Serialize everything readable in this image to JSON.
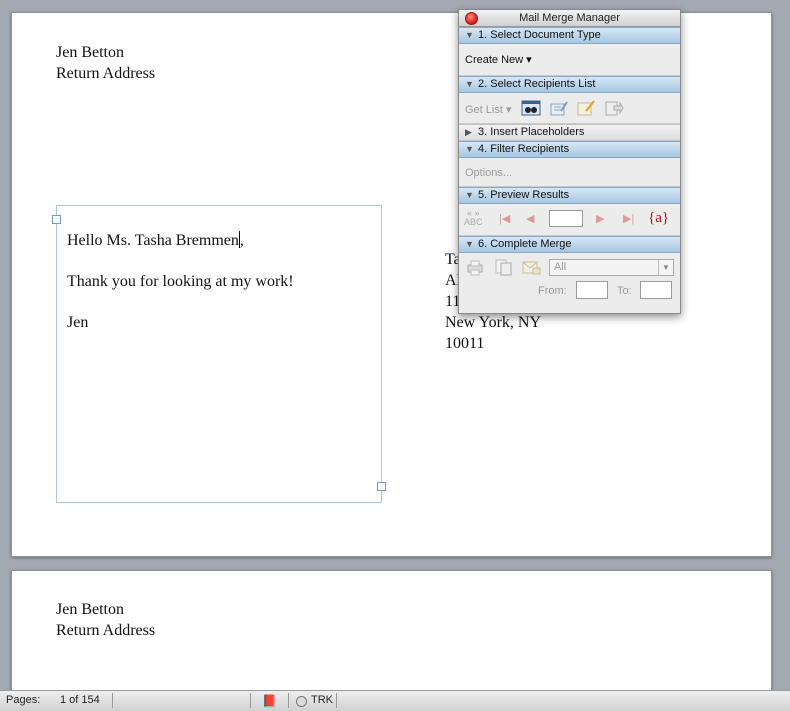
{
  "document": {
    "return_address": {
      "name": "Jen Betton",
      "line2": "Return Address"
    },
    "letter": {
      "greeting": "Hello Ms. Tasha Bremmen",
      "body": "Thank you for looking at my work!",
      "signature": "Jen"
    },
    "recipient_address": {
      "line1": "Ta",
      "line2": "Al",
      "line3": "11",
      "city_state": "New York, NY",
      "zip": "10011"
    }
  },
  "page2": {
    "return_address": {
      "name": "Jen Betton",
      "line2": "Return Address"
    }
  },
  "statusbar": {
    "pages_label": "Pages:",
    "pages_value": "1 of 154",
    "trk_label": "TRK"
  },
  "mail_merge": {
    "title": "Mail Merge Manager",
    "sections": {
      "s1": "1. Select Document Type",
      "s2": "2. Select Recipients List",
      "s3": "3. Insert Placeholders",
      "s4": "4. Filter Recipients",
      "s5": "5. Preview Results",
      "s6": "6. Complete Merge"
    },
    "create_new": "Create New",
    "get_list": "Get List",
    "options": "Options...",
    "preview": {
      "record": "",
      "abc_line1": "« »",
      "abc_line2": "ABC",
      "merge_field": "{a}"
    },
    "complete": {
      "select_value": "All",
      "from_label": "From:",
      "to_label": "To:"
    }
  },
  "icons": {
    "triangle_down": "▼",
    "triangle_right": "▶",
    "dropdown": "▾",
    "first": "|◀",
    "prev": "◀",
    "next": "▶",
    "last": "▶|",
    "book": "📕"
  }
}
